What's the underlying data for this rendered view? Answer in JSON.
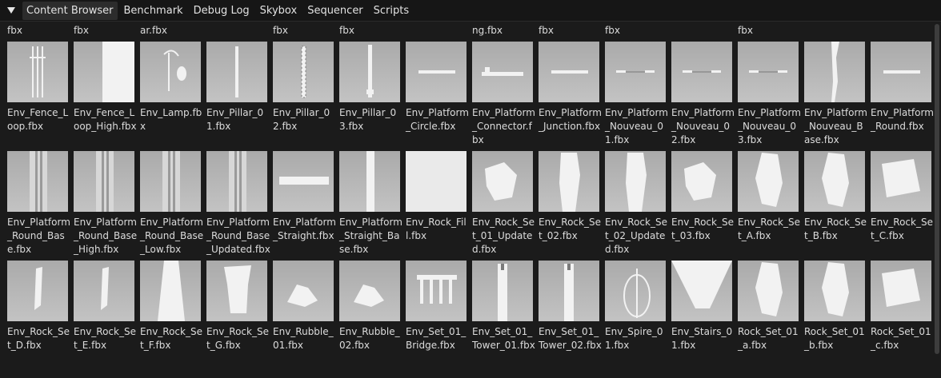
{
  "tabs": [
    {
      "label": "Content Browser",
      "active": true
    },
    {
      "label": "Benchmark",
      "active": false
    },
    {
      "label": "Debug Log",
      "active": false
    },
    {
      "label": "Skybox",
      "active": false
    },
    {
      "label": "Sequencer",
      "active": false
    },
    {
      "label": "Scripts",
      "active": false
    }
  ],
  "previous_row_labels": [
    "fbx",
    "fbx",
    "ar.fbx",
    "",
    "fbx",
    "fbx",
    "",
    "ng.fbx",
    "fbx",
    "fbx",
    "",
    "fbx",
    "",
    ""
  ],
  "rows": [
    [
      {
        "label": "Env_Fence_Loop.fbx",
        "icon": "fence-loop-thumbnail"
      },
      {
        "label": "Env_Fence_Loop_High.fbx",
        "icon": "fence-loop-high-thumbnail"
      },
      {
        "label": "Env_Lamp.fbx",
        "icon": "lamp-thumbnail"
      },
      {
        "label": "Env_Pillar_01.fbx",
        "icon": "pillar-thumbnail"
      },
      {
        "label": "Env_Pillar_02.fbx",
        "icon": "pillar-twisted-thumbnail"
      },
      {
        "label": "Env_Pillar_03.fbx",
        "icon": "pillar-tall-thumbnail"
      },
      {
        "label": "Env_Platform_Circle.fbx",
        "icon": "platform-flat-thumbnail"
      },
      {
        "label": "Env_Platform_Connector.fbx",
        "icon": "platform-connector-thumbnail"
      },
      {
        "label": "Env_Platform_Junction.fbx",
        "icon": "platform-flat-thumbnail"
      },
      {
        "label": "Env_Platform_Nouveau_01.fbx",
        "icon": "platform-nouveau-thumbnail"
      },
      {
        "label": "Env_Platform_Nouveau_02.fbx",
        "icon": "platform-nouveau-thumbnail"
      },
      {
        "label": "Env_Platform_Nouveau_03.fbx",
        "icon": "platform-nouveau-thumbnail"
      },
      {
        "label": "Env_Platform_Nouveau_Base.fbx",
        "icon": "nouveau-base-thumbnail"
      },
      {
        "label": "Env_Platform_Round.fbx",
        "icon": "platform-flat-thumbnail"
      }
    ],
    [
      {
        "label": "Env_Platform_Round_Base.fbx",
        "icon": "round-base-thumbnail"
      },
      {
        "label": "Env_Platform_Round_Base_High.fbx",
        "icon": "round-base-thumbnail"
      },
      {
        "label": "Env_Platform_Round_Base_Low.fbx",
        "icon": "round-base-thumbnail"
      },
      {
        "label": "Env_Platform_Round_Base_Updated.fbx",
        "icon": "round-base-thumbnail"
      },
      {
        "label": "Env_Platform_Straight.fbx",
        "icon": "platform-straight-thumbnail"
      },
      {
        "label": "Env_Platform_Straight_Base.fbx",
        "icon": "straight-base-thumbnail"
      },
      {
        "label": "Env_Rock_Fill.fbx",
        "icon": "rock-fill-thumbnail"
      },
      {
        "label": "Env_Rock_Set_01_Updated.fbx",
        "icon": "rock-chunk-thumbnail"
      },
      {
        "label": "Env_Rock_Set_02.fbx",
        "icon": "rock-column-thumbnail"
      },
      {
        "label": "Env_Rock_Set_02_Updated.fbx",
        "icon": "rock-column-thumbnail"
      },
      {
        "label": "Env_Rock_Set_03.fbx",
        "icon": "rock-chunk-thumbnail"
      },
      {
        "label": "Env_Rock_Set_A.fbx",
        "icon": "rock-tall-thumbnail"
      },
      {
        "label": "Env_Rock_Set_B.fbx",
        "icon": "rock-tall-thumbnail"
      },
      {
        "label": "Env_Rock_Set_C.fbx",
        "icon": "rock-boulder-thumbnail"
      }
    ],
    [
      {
        "label": "Env_Rock_Set_D.fbx",
        "icon": "rock-sliver-thumbnail"
      },
      {
        "label": "Env_Rock_Set_E.fbx",
        "icon": "rock-sliver-thumbnail"
      },
      {
        "label": "Env_Rock_Set_F.fbx",
        "icon": "rock-spire-thumbnail"
      },
      {
        "label": "Env_Rock_Set_G.fbx",
        "icon": "rock-block-thumbnail"
      },
      {
        "label": "Env_Rubble_01.fbx",
        "icon": "rubble-thumbnail"
      },
      {
        "label": "Env_Rubble_02.fbx",
        "icon": "rubble-thumbnail"
      },
      {
        "label": "Env_Set_01_Bridge.fbx",
        "icon": "bridge-thumbnail"
      },
      {
        "label": "Env_Set_01_Tower_01.fbx",
        "icon": "tower-thumbnail"
      },
      {
        "label": "Env_Set_01_Tower_02.fbx",
        "icon": "tower-thumbnail"
      },
      {
        "label": "Env_Spire_01.fbx",
        "icon": "spire-thumbnail"
      },
      {
        "label": "Env_Stairs_01.fbx",
        "icon": "stairs-thumbnail"
      },
      {
        "label": "Rock_Set_01_a.fbx",
        "icon": "rock-tall-thumbnail"
      },
      {
        "label": "Rock_Set_01_b.fbx",
        "icon": "rock-tall-thumbnail"
      },
      {
        "label": "Rock_Set_01_c.fbx",
        "icon": "rock-boulder-thumbnail"
      }
    ]
  ]
}
